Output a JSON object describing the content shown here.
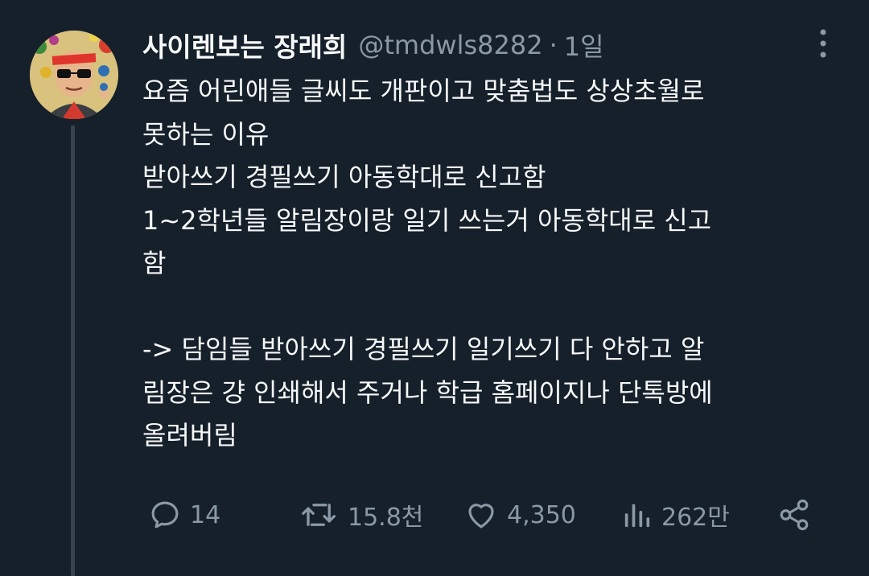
{
  "tweet": {
    "display_name": "사이렌보는 장래희",
    "handle": "@tmdwls8282",
    "separator": "·",
    "time": "1일",
    "lines": [
      "요즘 어린애들 글씨도 개판이고 맞춤법도 상상초월로",
      "못하는 이유",
      "받아쓰기 경필쓰기 아동학대로 신고함",
      "1~2학년들 알림장이랑 일기 쓰는거 아동학대로 신고",
      "함",
      "",
      "-> 담임들 받아쓰기 경필쓰기 일기쓰기 다 안하고 알",
      "림장은 걍 인쇄해서 주거나 학급 홈페이지나 단톡방에",
      "올려버림"
    ]
  },
  "actions": {
    "reply_count": "14",
    "retweet_count": "15.8천",
    "like_count": "4,350",
    "view_count": "262만"
  },
  "icons": {
    "reply": "reply-icon",
    "retweet": "retweet-icon",
    "like": "heart-icon",
    "views": "views-icon",
    "share": "share-icon",
    "more": "more-vertical-icon"
  },
  "colors": {
    "background": "#15202b",
    "text": "#f7f9f9",
    "secondary": "#8b98a5",
    "thread_line": "#38444d"
  }
}
